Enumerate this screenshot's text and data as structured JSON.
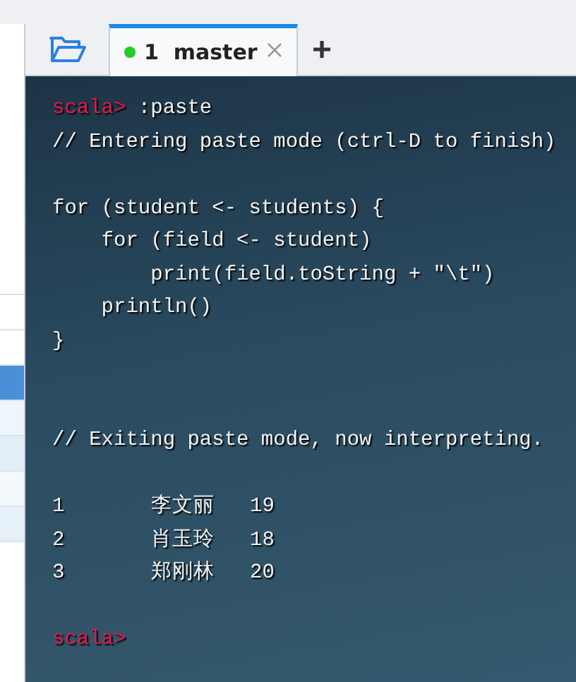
{
  "tabs": [
    {
      "label": "1  master",
      "selected": true,
      "connected": true
    }
  ],
  "terminal": {
    "lines": [
      {
        "kind": "prompt",
        "prompt": "scala>",
        "text": " :paste"
      },
      {
        "kind": "text",
        "text": "// Entering paste mode (ctrl-D to finish)"
      },
      {
        "kind": "blank"
      },
      {
        "kind": "text",
        "text": "for (student <- students) {"
      },
      {
        "kind": "text",
        "text": "    for (field <- student)"
      },
      {
        "kind": "text",
        "text": "        print(field.toString + \"\\t\")"
      },
      {
        "kind": "text",
        "text": "    println()"
      },
      {
        "kind": "text",
        "text": "}"
      },
      {
        "kind": "blank"
      },
      {
        "kind": "blank"
      },
      {
        "kind": "text",
        "text": "// Exiting paste mode, now interpreting."
      },
      {
        "kind": "blank"
      },
      {
        "kind": "row",
        "cells": [
          "1",
          "李文丽",
          "19"
        ]
      },
      {
        "kind": "row",
        "cells": [
          "2",
          "肖玉玲",
          "18"
        ]
      },
      {
        "kind": "row",
        "cells": [
          "3",
          "郑刚林",
          "20"
        ]
      },
      {
        "kind": "blank"
      },
      {
        "kind": "prompt",
        "prompt": "scala>"
      }
    ]
  }
}
